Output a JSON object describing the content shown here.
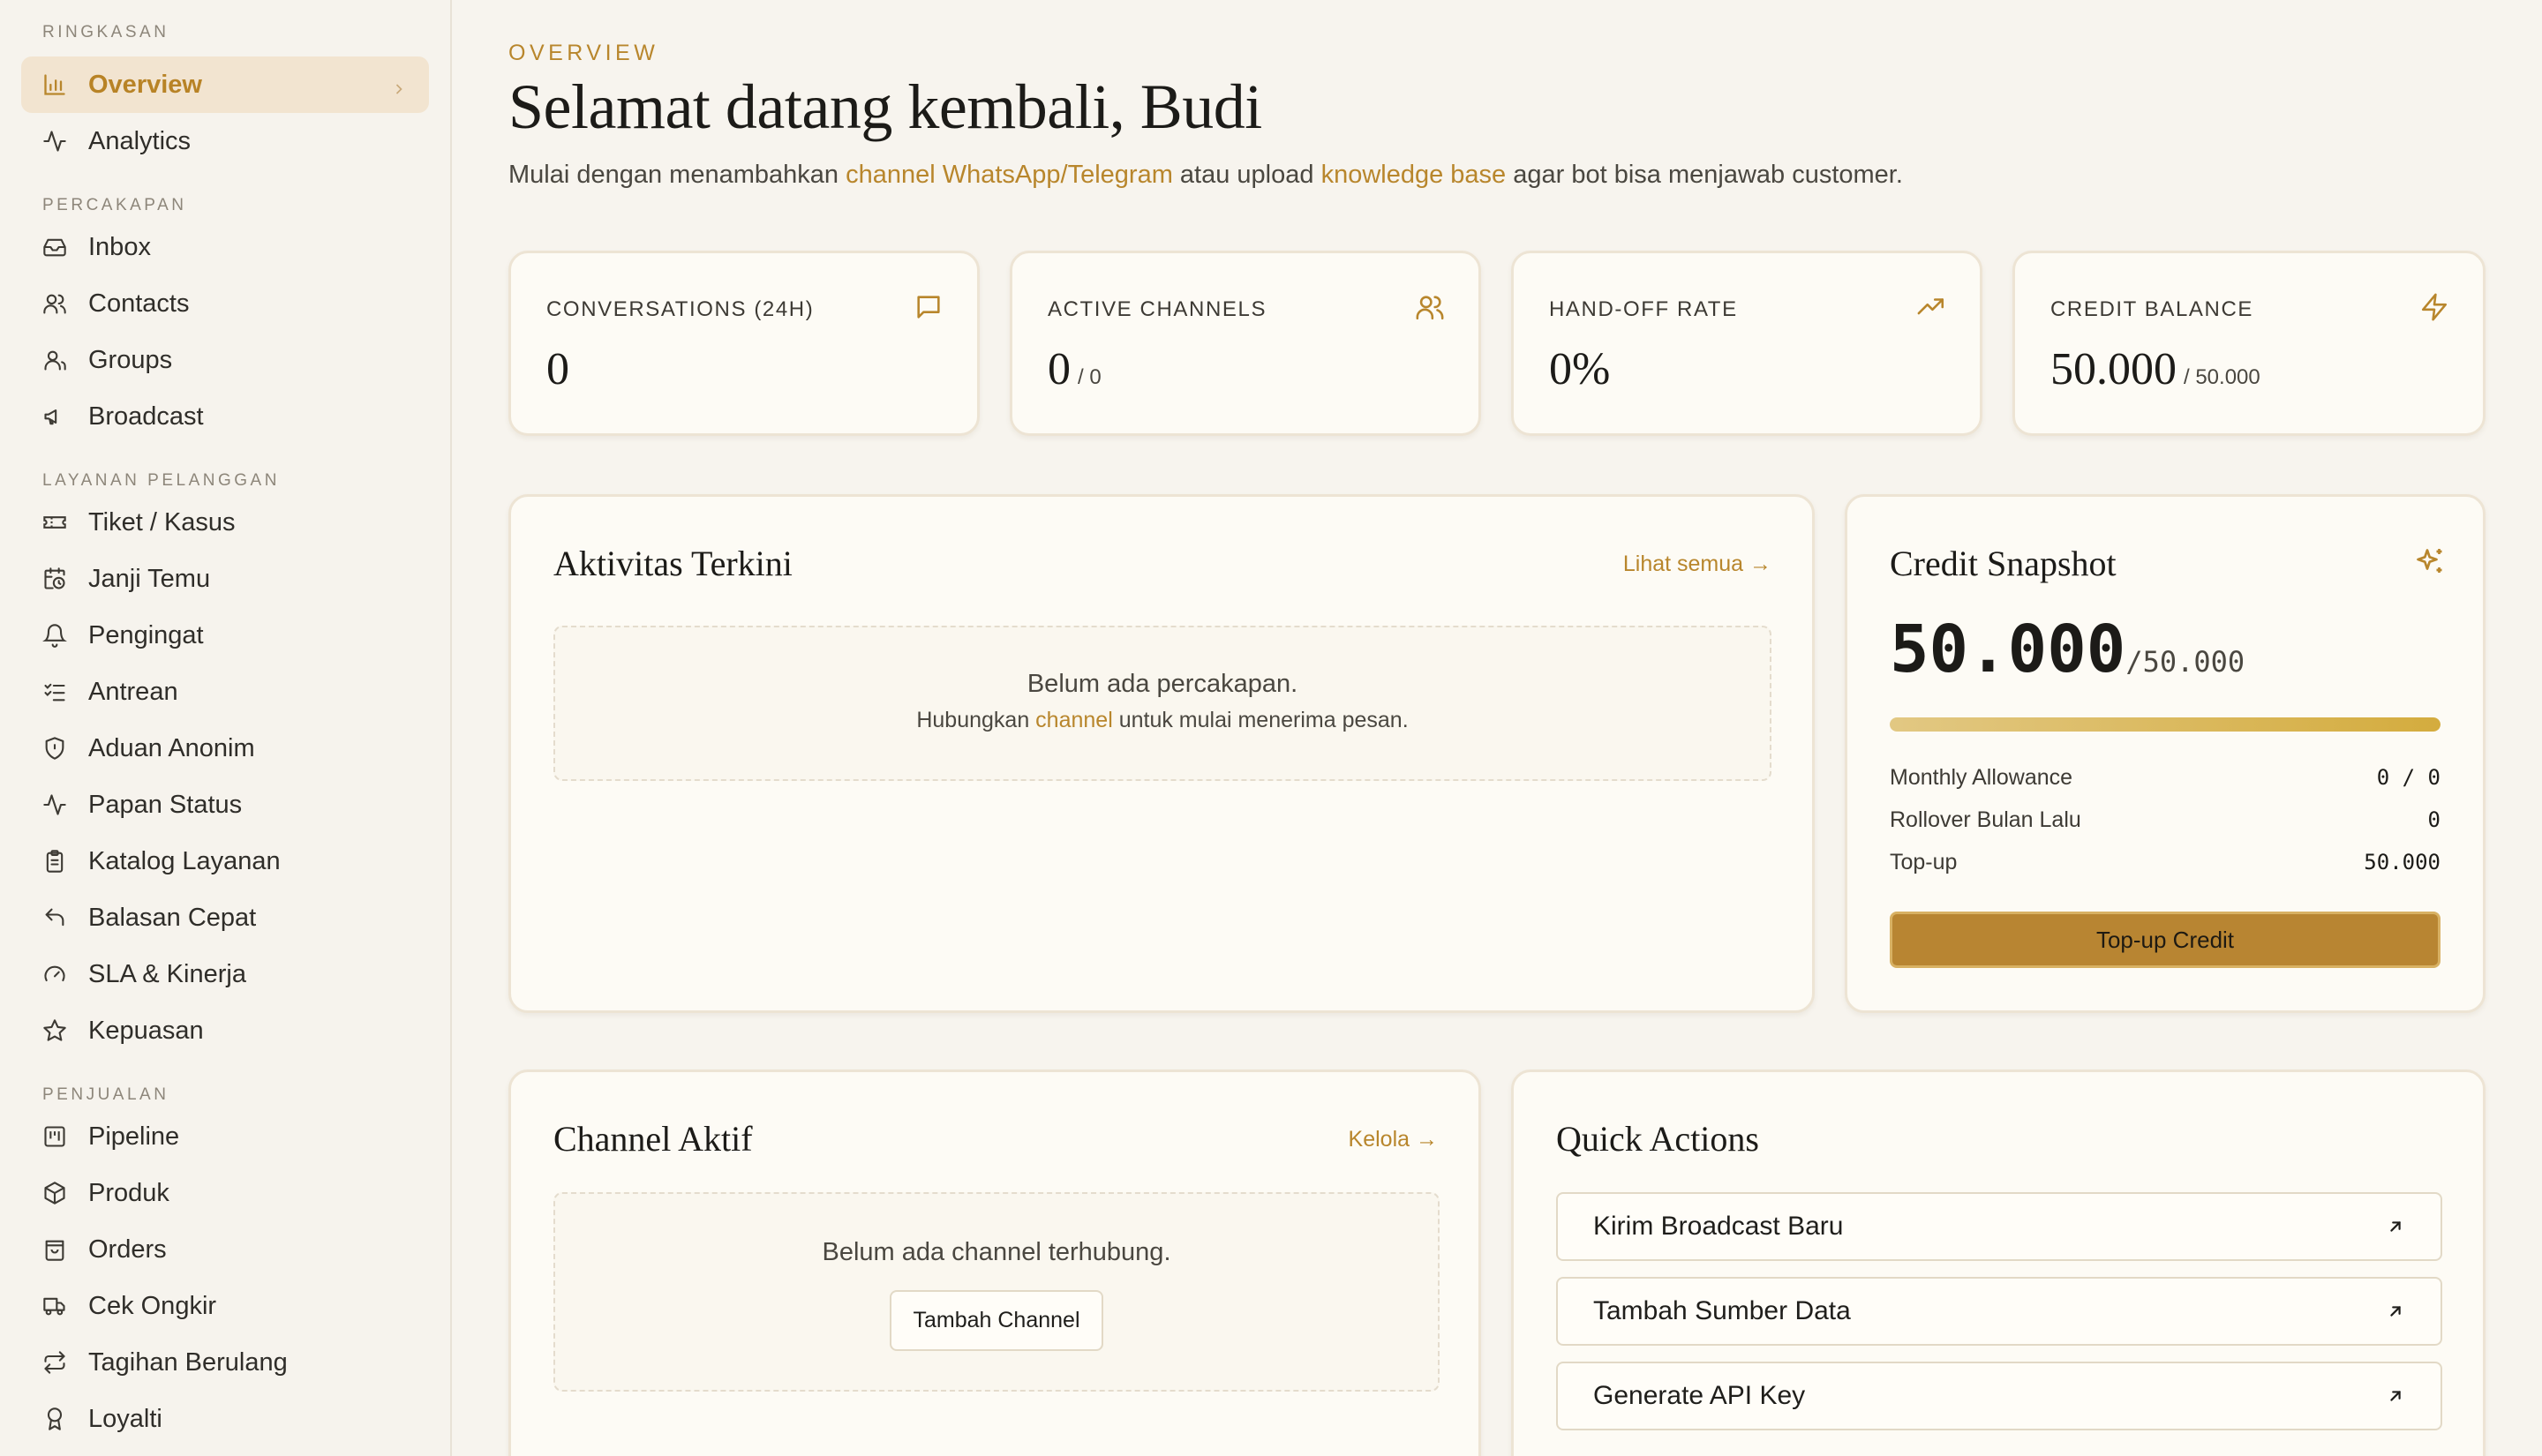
{
  "sidebar": {
    "sections": [
      {
        "label": "RINGKASAN",
        "items": [
          {
            "label": "Overview",
            "icon": "bar-chart-icon",
            "active": true
          },
          {
            "label": "Analytics",
            "icon": "activity-icon"
          }
        ]
      },
      {
        "label": "PERCAKAPAN",
        "items": [
          {
            "label": "Inbox",
            "icon": "inbox-icon"
          },
          {
            "label": "Contacts",
            "icon": "users-icon"
          },
          {
            "label": "Groups",
            "icon": "group-icon"
          },
          {
            "label": "Broadcast",
            "icon": "megaphone-icon"
          }
        ]
      },
      {
        "label": "LAYANAN PELANGGAN",
        "items": [
          {
            "label": "Tiket / Kasus",
            "icon": "ticket-icon"
          },
          {
            "label": "Janji Temu",
            "icon": "calendar-clock-icon"
          },
          {
            "label": "Pengingat",
            "icon": "bell-icon"
          },
          {
            "label": "Antrean",
            "icon": "list-checks-icon"
          },
          {
            "label": "Aduan Anonim",
            "icon": "shield-icon"
          },
          {
            "label": "Papan Status",
            "icon": "activity-icon"
          },
          {
            "label": "Katalog Layanan",
            "icon": "clipboard-icon"
          },
          {
            "label": "Balasan Cepat",
            "icon": "reply-icon"
          },
          {
            "label": "SLA & Kinerja",
            "icon": "gauge-icon"
          },
          {
            "label": "Kepuasan",
            "icon": "star-icon"
          }
        ]
      },
      {
        "label": "PENJUALAN",
        "items": [
          {
            "label": "Pipeline",
            "icon": "kanban-icon"
          },
          {
            "label": "Produk",
            "icon": "package-icon"
          },
          {
            "label": "Orders",
            "icon": "shopping-bag-icon"
          },
          {
            "label": "Cek Ongkir",
            "icon": "truck-icon"
          },
          {
            "label": "Tagihan Berulang",
            "icon": "repeat-icon"
          },
          {
            "label": "Loyalti",
            "icon": "award-icon"
          }
        ]
      }
    ]
  },
  "header": {
    "eyebrow": "OVERVIEW",
    "title": "Selamat datang kembali, Budi",
    "subtitle_prefix": "Mulai dengan menambahkan ",
    "subtitle_link1": "channel WhatsApp/Telegram",
    "subtitle_mid": " atau upload ",
    "subtitle_link2": "knowledge base",
    "subtitle_suffix": " agar bot bisa menjawab customer."
  },
  "stats": [
    {
      "label": "CONVERSATIONS (24H)",
      "value": "0",
      "sub": "",
      "icon": "message-square-icon"
    },
    {
      "label": "ACTIVE CHANNELS",
      "value": "0",
      "sub": "/ 0",
      "icon": "users-icon"
    },
    {
      "label": "HAND-OFF RATE",
      "value": "0%",
      "sub": "",
      "icon": "trending-up-icon"
    },
    {
      "label": "CREDIT BALANCE",
      "value": "50.000",
      "sub": "/ 50.000",
      "icon": "zap-icon"
    }
  ],
  "activity": {
    "title": "Aktivitas Terkini",
    "link": "Lihat semua →",
    "empty_main": "Belum ada percakapan.",
    "empty_sub_prefix": "Hubungkan ",
    "empty_sub_link": "channel",
    "empty_sub_suffix": " untuk mulai menerima pesan."
  },
  "credit": {
    "title": "Credit Snapshot",
    "icon": "sparkles-icon",
    "amount": "50.000",
    "of": "/50.000",
    "progress": 1.0,
    "rows": [
      {
        "label": "Monthly Allowance",
        "value": "0 / 0"
      },
      {
        "label": "Rollover Bulan Lalu",
        "value": "0"
      },
      {
        "label": "Top-up",
        "value": "50.000"
      }
    ],
    "button": "Top-up Credit"
  },
  "channels": {
    "title": "Channel Aktif",
    "link": "Kelola →",
    "empty_main": "Belum ada channel terhubung.",
    "button": "Tambah Channel"
  },
  "quick_actions": {
    "title": "Quick Actions",
    "items": [
      "Kirim Broadcast Baru",
      "Tambah Sumber Data",
      "Generate API Key"
    ]
  },
  "colors": {
    "accent": "#b8862c",
    "background": "#f7f4ee",
    "card": "#fdfbf5",
    "active_nav_bg": "#f2e4d0"
  }
}
